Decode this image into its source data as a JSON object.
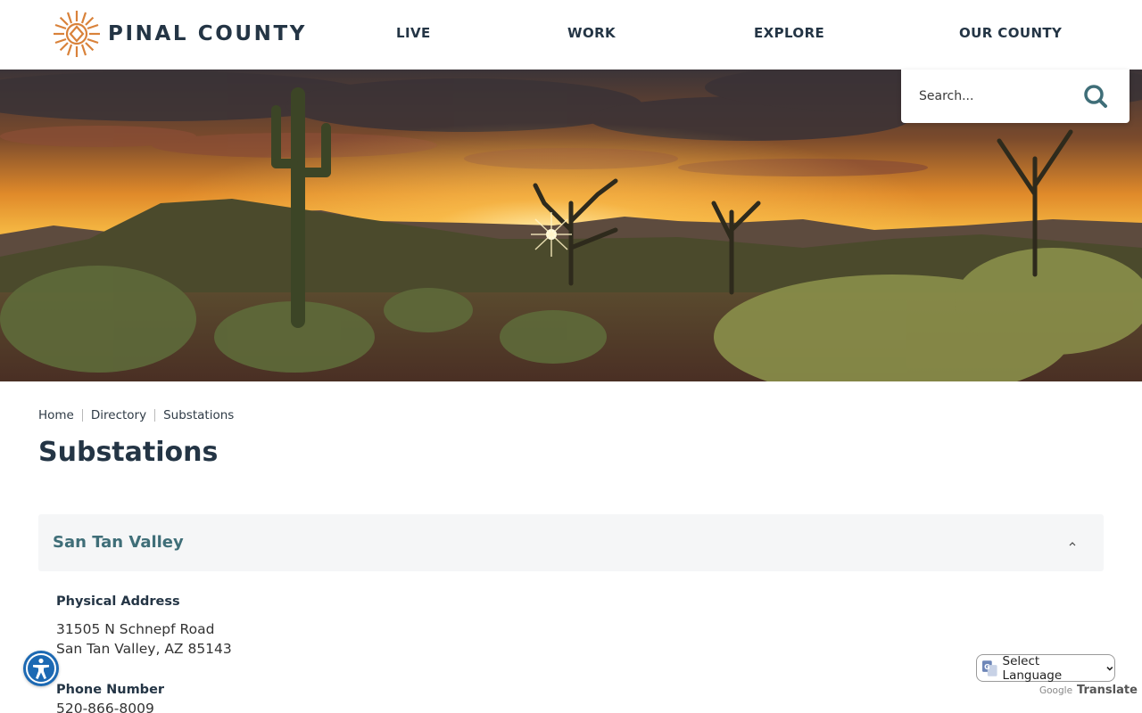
{
  "site": {
    "logo_text": "PINAL COUNTY"
  },
  "nav": [
    {
      "label": "LIVE"
    },
    {
      "label": "WORK"
    },
    {
      "label": "EXPLORE"
    },
    {
      "label": "OUR COUNTY"
    }
  ],
  "search": {
    "placeholder": "Search..."
  },
  "breadcrumb": [
    {
      "label": "Home"
    },
    {
      "label": "Directory"
    },
    {
      "label": "Substations"
    }
  ],
  "page": {
    "title": "Substations"
  },
  "accordion": {
    "title": "San Tan Valley",
    "expanded": true,
    "fields": [
      {
        "label": "Physical Address",
        "lines": [
          "31505 N Schnepf Road",
          "San Tan Valley, AZ 85143"
        ]
      },
      {
        "label": "Phone Number",
        "lines": [
          "520-866-8009"
        ]
      }
    ]
  },
  "translate": {
    "label": "Select Language",
    "powered_by": "Google",
    "translate_word": "Translate"
  },
  "colors": {
    "brand_dark": "#243545",
    "accent_teal": "#3f6e78",
    "logo_orange": "#d9823a",
    "a11y_blue": "#1c69b3"
  },
  "icons": [
    "sun-logo-icon",
    "search-icon",
    "chevron-up-icon",
    "accessibility-icon",
    "google-translate-icon",
    "dropdown-arrow-icon"
  ]
}
